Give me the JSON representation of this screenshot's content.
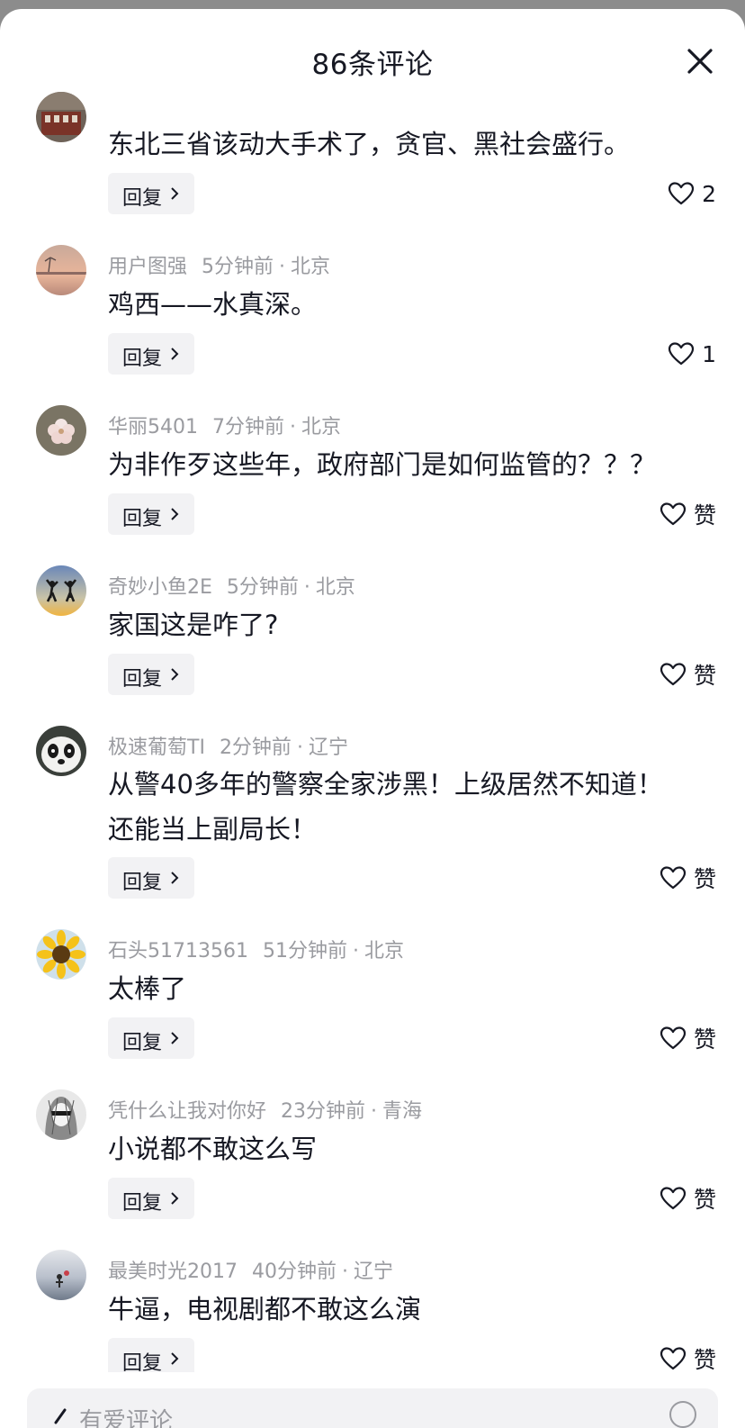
{
  "header": {
    "title": "86条评论"
  },
  "comments": [
    {
      "username": "",
      "time": "",
      "location": "",
      "text": "东北三省该动大手术了，贪官、黑社会盛行。",
      "reply_label": "回复",
      "like_label": "2",
      "avatar": "building-avatar"
    },
    {
      "username": "用户图强",
      "time": "5分钟前",
      "location": "北京",
      "text": "鸡西——水真深。",
      "reply_label": "回复",
      "like_label": "1",
      "avatar": "sunset-avatar"
    },
    {
      "username": "华丽5401",
      "time": "7分钟前",
      "location": "北京",
      "text": "为非作歹这些年，政府部门是如何监管的？？？",
      "reply_label": "回复",
      "like_label": "赞",
      "avatar": "flower-avatar"
    },
    {
      "username": "奇妙小鱼2E",
      "time": "5分钟前",
      "location": "北京",
      "text": "家国这是咋了?",
      "reply_label": "回复",
      "like_label": "赞",
      "avatar": "jumping-avatar"
    },
    {
      "username": "极速葡萄TI",
      "time": "2分钟前",
      "location": "辽宁",
      "text": "从警40多年的警察全家涉黑！上级居然不知道！还能当上副局长！",
      "reply_label": "回复",
      "like_label": "赞",
      "avatar": "panda-avatar"
    },
    {
      "username": "石头51713561",
      "time": "51分钟前",
      "location": "北京",
      "text": "太棒了",
      "reply_label": "回复",
      "like_label": "赞",
      "avatar": "sunflower-avatar"
    },
    {
      "username": "凭什么让我对你好",
      "time": "23分钟前",
      "location": "青海",
      "text": "小说都不敢这么写",
      "reply_label": "回复",
      "like_label": "赞",
      "avatar": "sketch-avatar"
    },
    {
      "username": "最美时光2017",
      "time": "40分钟前",
      "location": "辽宁",
      "text": "牛逼，电视剧都不敢这么演",
      "reply_label": "回复",
      "like_label": "赞",
      "avatar": "sea-avatar"
    }
  ],
  "footer": {
    "placeholder": "有爱评论"
  }
}
